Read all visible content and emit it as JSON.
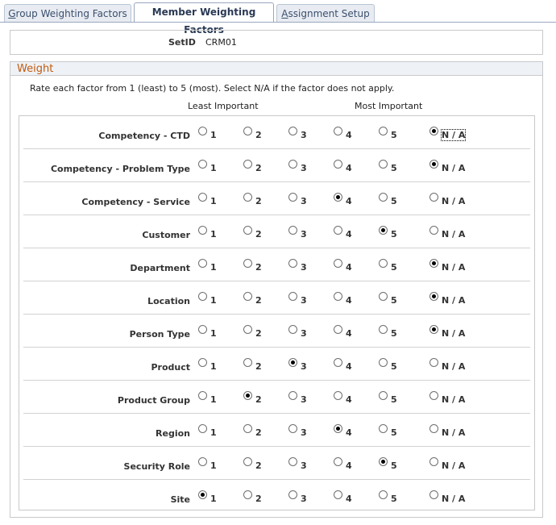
{
  "tabs": [
    {
      "label": "Group Weighting Factors",
      "underline": "G",
      "rest": "roup Weighting Factors",
      "active": false
    },
    {
      "label": "Member Weighting Factors",
      "active": true
    },
    {
      "label": "Assignment Setup",
      "underline": "A",
      "rest": "ssignment Setup",
      "active": false
    }
  ],
  "setid": {
    "label": "SetID",
    "value": "CRM01"
  },
  "weight": {
    "title": "Weight",
    "instructions": "Rate each factor from 1 (least) to 5 (most). Select N/A if the factor does not apply.",
    "least_label": "Least Important",
    "most_label": "Most Important",
    "options": [
      "1",
      "2",
      "3",
      "4",
      "5",
      "N / A"
    ],
    "factors": [
      {
        "name": "Competency - CTD",
        "selected": "N / A"
      },
      {
        "name": "Competency - Problem Type",
        "selected": "N / A"
      },
      {
        "name": "Competency - Service",
        "selected": "4"
      },
      {
        "name": "Customer",
        "selected": "5"
      },
      {
        "name": "Department",
        "selected": "N / A"
      },
      {
        "name": "Location",
        "selected": "N / A"
      },
      {
        "name": "Person Type",
        "selected": "N / A"
      },
      {
        "name": "Product",
        "selected": "3"
      },
      {
        "name": "Product Group",
        "selected": "2"
      },
      {
        "name": "Region",
        "selected": "4"
      },
      {
        "name": "Security Role",
        "selected": "5"
      },
      {
        "name": "Site",
        "selected": "1"
      }
    ]
  },
  "colors": {
    "section_title": "#c25a0c",
    "tab_border": "#99a8be",
    "box_border": "#c9c9c9"
  }
}
